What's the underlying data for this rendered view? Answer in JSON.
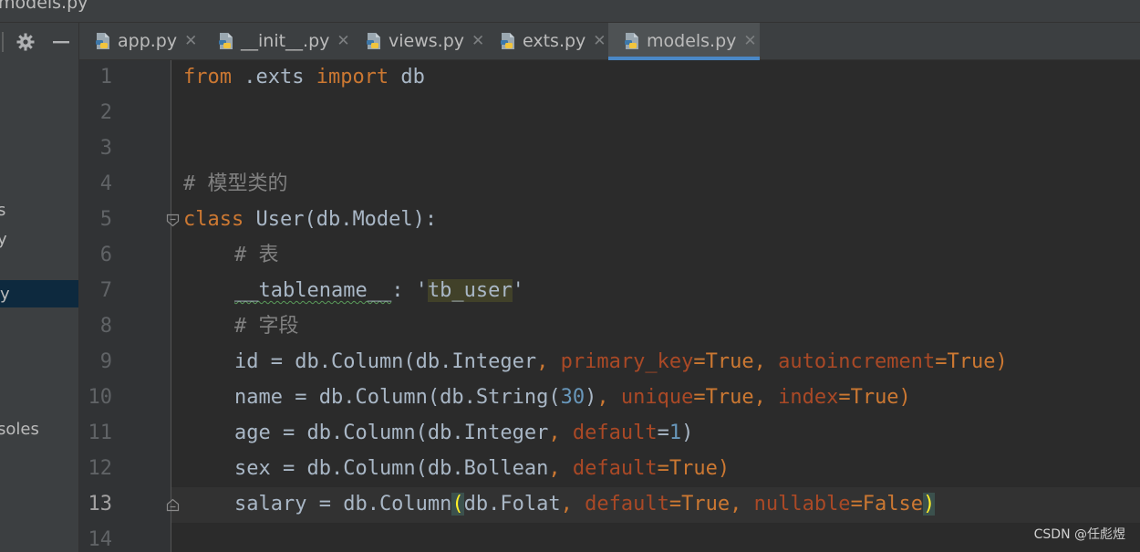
{
  "window": {
    "title": "models.py"
  },
  "sidebar": {
    "truncated_items": [
      "s",
      "y",
      "y",
      "soles"
    ]
  },
  "tabs": [
    {
      "label": "app.py",
      "active": false
    },
    {
      "label": "__init__.py",
      "active": false
    },
    {
      "label": "views.py",
      "active": false
    },
    {
      "label": "exts.py",
      "active": false
    },
    {
      "label": "models.py",
      "active": true
    }
  ],
  "editor": {
    "line_numbers": [
      "1",
      "2",
      "3",
      "4",
      "5",
      "6",
      "7",
      "8",
      "9",
      "10",
      "11",
      "12",
      "13",
      "14"
    ],
    "current_line": "13",
    "lines": {
      "l1": {
        "kw1": "from",
        "t1": " .exts ",
        "kw2": "import",
        "t2": " db"
      },
      "l4": {
        "comment": "# 模型类的"
      },
      "l5": {
        "kw": "class",
        "t": " User(db.Model):"
      },
      "l6": {
        "comment": "# 表"
      },
      "l7": {
        "name": "__tablename__",
        "t1": ": '",
        "str": "tb_user",
        "t2": "'"
      },
      "l8": {
        "comment": "# 字段"
      },
      "l9": {
        "t1": "id = db.Column(db.Integer",
        "c1": ", ",
        "p1": "primary_key",
        "t2": "=True",
        "c2": ", ",
        "p2": "autoincrement",
        "t3": "=True)"
      },
      "l10": {
        "t1": "name = db.Column(db.String(",
        "n": "30",
        "t2": ")",
        "c1": ", ",
        "p1": "unique",
        "t3": "=True",
        "c2": ", ",
        "p2": "index",
        "t4": "=True)"
      },
      "l11": {
        "t1": "age = db.Column(db.Integer",
        "c1": ", ",
        "p1": "default",
        "t2": "=",
        "n": "1",
        "t3": ")"
      },
      "l12": {
        "t1": "sex = db.Column(db.Bollean",
        "c1": ", ",
        "p1": "default",
        "t2": "=True)"
      },
      "l13": {
        "t1": "salary = db.Column",
        "b1": "(",
        "t2": "db.Folat",
        "c1": ", ",
        "p1": "default",
        "t3": "=True",
        "c2": ", ",
        "p2": "nullable",
        "t4": "=False",
        "b2": ")"
      }
    }
  },
  "watermark": "CSDN @任彪煜",
  "colors": {
    "background": "#2b2b2b",
    "keyword": "#cc7832",
    "comment": "#808080",
    "number": "#6897bb",
    "param": "#aa4926",
    "accent": "#4a88c7"
  },
  "icons": [
    "gear-icon",
    "minimize-icon",
    "python-file-icon",
    "close-icon",
    "fold-icon"
  ]
}
